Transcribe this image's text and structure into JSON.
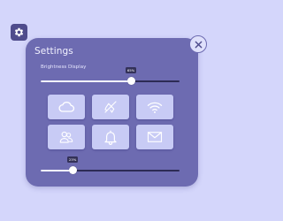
{
  "header": {
    "title": "Settings"
  },
  "brightness": {
    "label": "Brightness Display",
    "value": 65,
    "value_label": "65%"
  },
  "second_slider": {
    "value": 23,
    "value_label": "23%"
  },
  "tiles": [
    {
      "icon": "cloud-icon"
    },
    {
      "icon": "airplane-icon"
    },
    {
      "icon": "wifi-icon"
    },
    {
      "icon": "contacts-icon"
    },
    {
      "icon": "bell-icon"
    },
    {
      "icon": "mail-icon"
    }
  ],
  "colors": {
    "background": "#d4d6fb",
    "panel": "#6d6bb1",
    "tile": "#c8cbf5",
    "tooltip": "#333158"
  }
}
